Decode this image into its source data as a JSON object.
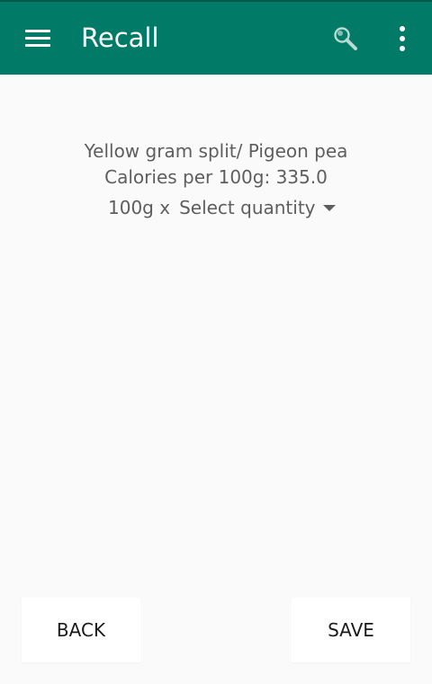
{
  "toolbar": {
    "title": "Recall",
    "menu_icon": "hamburger-menu-icon",
    "search_icon": "search-icon",
    "overflow_icon": "more-vertical-icon",
    "background_color": "#017a67"
  },
  "content": {
    "food_name": "Yellow gram split/ Pigeon pea",
    "calories": "Calories per 100g: 335.0",
    "quantity_prefix": "100g x",
    "quantity_select": {
      "selected": "Select quantity",
      "icon": "dropdown-caret-icon"
    }
  },
  "actions": {
    "back_label": "BACK",
    "save_label": "SAVE"
  }
}
